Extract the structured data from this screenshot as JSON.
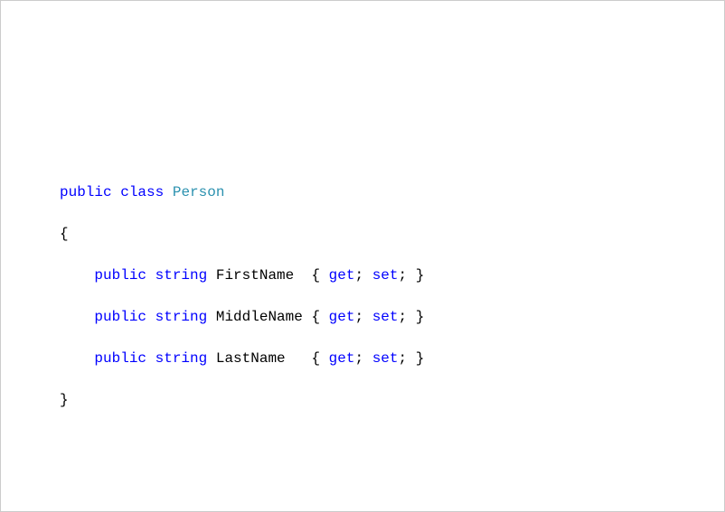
{
  "code": {
    "line1": {
      "public": "public",
      "class": "class",
      "typename": "Person"
    },
    "line2": {
      "brace": "{"
    },
    "prop1": {
      "indent": "    ",
      "public": "public",
      "type": "string",
      "name": "FirstName ",
      "open": " { ",
      "get": "get",
      "semi1": "; ",
      "set": "set",
      "semi2": "; }"
    },
    "prop2": {
      "indent": "    ",
      "public": "public",
      "type": "string",
      "name": "MiddleName",
      "open": " { ",
      "get": "get",
      "semi1": "; ",
      "set": "set",
      "semi2": "; }"
    },
    "prop3": {
      "indent": "    ",
      "public": "public",
      "type": "string",
      "name": "LastName  ",
      "open": " { ",
      "get": "get",
      "semi1": "; ",
      "set": "set",
      "semi2": "; }"
    },
    "line6": {
      "brace": "}"
    }
  },
  "colors": {
    "keyword": "#0000ff",
    "type": "#2b91af",
    "plain": "#000000"
  }
}
